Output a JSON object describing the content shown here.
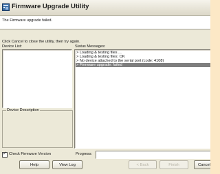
{
  "window": {
    "title": "Firmware Upgrade Utility"
  },
  "header": {
    "message": "The Firmware upgrade failed."
  },
  "instruction": "Click Cancel to close the utility, then try again.",
  "device_list": {
    "label": "Device List:"
  },
  "device_description": {
    "title": "Device Description"
  },
  "status_messages": {
    "label": "Status Messages:",
    "lines": [
      "> Loading & testing files ...",
      "> Loading & testing files: OK",
      "> No device attached to the serial port (code: 4108)",
      "> Firmware upgrade: failed"
    ],
    "selected_index": 3
  },
  "check_firmware_version": {
    "label": "Check Firmware Version",
    "checked": true
  },
  "progress": {
    "label": "Progress:",
    "value": 0
  },
  "buttons": {
    "help": "Help",
    "view_log": "View Log",
    "back": "< Back",
    "finish": "Finish",
    "cancel": "Cancel"
  }
}
